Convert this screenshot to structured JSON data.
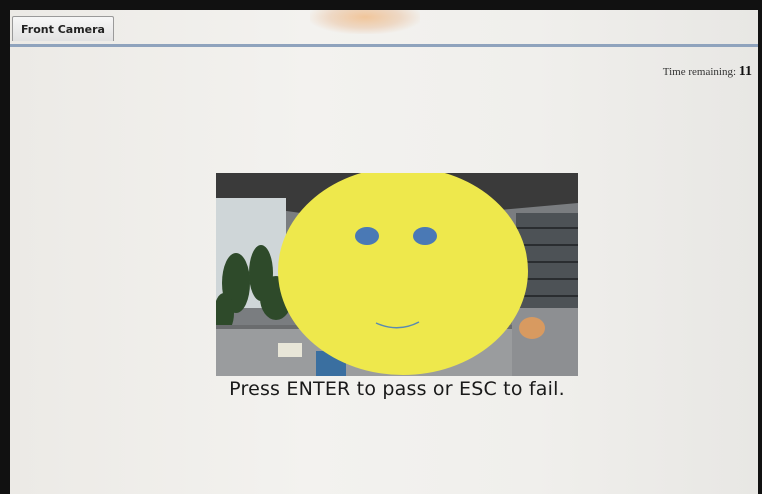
{
  "window": {
    "tab_label": "Front Camera"
  },
  "timer": {
    "label": "Time remaining:",
    "value": "11"
  },
  "camera": {
    "overlay": "smiley-face-icon",
    "face_color": "#eee84c",
    "eye_color": "#4a79b5"
  },
  "instructions": {
    "prompt": "Press ENTER to pass or ESC to fail."
  }
}
